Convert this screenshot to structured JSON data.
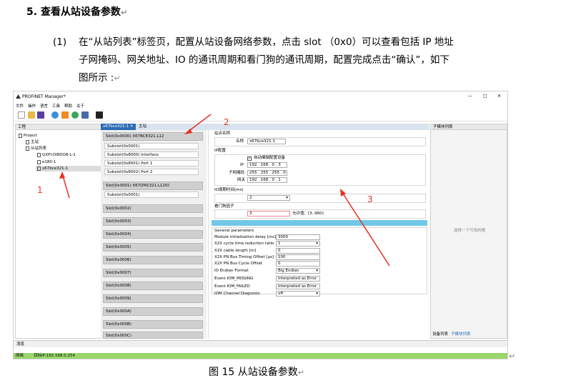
{
  "document": {
    "heading": "5.  查看从站设备参数",
    "para_number": "(1)",
    "para_lines": [
      "在“从站列表”标签页，配置从站设备网络参数，点击 slot （0x0）可以查看包括 IP 地址",
      "子网掩码、网关地址、IO 的通讯周期和看门狗的通讯周期，配置完成点击“确认”，如下",
      "图所示 :"
    ],
    "caption": "图 15 从站设备参数",
    "para_mark": "↵"
  },
  "app": {
    "title": "PROFINET Manager*",
    "window_controls": [
      "—",
      "□",
      "✕"
    ],
    "menu": [
      "文件",
      "操作",
      "语言",
      "工具",
      "帮助",
      "关于"
    ],
    "toolbar_icons": [
      "new-file-icon",
      "open-folder-icon",
      "save-icon",
      "refresh-icon",
      "export-icon",
      "network-icon",
      "device-icon",
      "help-icon"
    ],
    "left_panel": {
      "header": "工程",
      "tree": [
        "Project",
        "主站",
        "从站列表",
        "GXPI-DI8DO8-L-1",
        "e180-1",
        "x67bce321-1"
      ]
    },
    "tabs": [
      "x67bce321-1  ✕",
      "主站"
    ],
    "slots": {
      "slot0": "Slot(0x0000)   X67BCE321.L12",
      "slot0_subslots": [
        "Subslot(0x0001)",
        "Subslot(0x8000)   Interface",
        "Subslot(0x8001)   Port 1",
        "Subslot(0x8002)   Port 2"
      ],
      "slot1": "Slot(0x0001)     X67DM1321.L12IO",
      "slot1_subslots": [
        "Subslot(0x0001)"
      ],
      "empty_slots": [
        "Slot(0x0002)",
        "Slot(0x0003)",
        "Slot(0x0004)",
        "Slot(0x0005)",
        "Slot(0x0006)",
        "Slot(0x0007)",
        "Slot(0x0008)",
        "Slot(0x0009)",
        "Slot(0x000A)",
        "Slot(0x000B)",
        "Slot(0x000C)"
      ]
    },
    "props": {
      "station_name_group": "站点名称",
      "name_label": "名称",
      "name_value": "x67bce321-1",
      "ip_group": "IP配置",
      "auto_config_label": "自动编辑配置设备",
      "ip_label": "IP",
      "ip_value": "192 . 168 .  0  .  3",
      "mask_label": "子网掩码",
      "mask_value": "255 . 255 . 255 .  0",
      "gateway_label": "网关",
      "gateway_value": "192 . 168 .  0  .  1",
      "io_cycle_group": "IO周期时间(ms)",
      "io_cycle_value": "2",
      "watchdog_group": "看门狗因子",
      "watchdog_value": "3",
      "watchdog_range": "允许值：[3..960]",
      "general_title": "General parameters",
      "params": [
        {
          "name": "Module initialization delay [ms]",
          "value": "3000"
        },
        {
          "name": "X2X cycle time reduction ratio",
          "value": "1"
        },
        {
          "name": "X2X cable length [m]",
          "value": "0"
        },
        {
          "name": "X2X PN Bus Timing Offset [µs]",
          "value": "100"
        },
        {
          "name": "X2X PN Bus Cycle Offset",
          "value": "0"
        },
        {
          "name": "IO Endian Format",
          "value": "Big Endian"
        },
        {
          "name": "Event IOM_MISSING",
          "value": "Interpreted as Error"
        },
        {
          "name": "Event IOM_FAILED",
          "value": "Interpreted as Error"
        },
        {
          "name": "IOM Channel Diagnosis",
          "value": "off"
        }
      ]
    },
    "right_panel": {
      "header": "子模块列表",
      "placeholder": "选择一个可用的槽",
      "bottom_tabs": [
        "设备列表",
        "子模块列表"
      ]
    },
    "output_label": "消息",
    "status_connected": "网络",
    "status_ip": "目标IP:192.168.0.254"
  },
  "annotations": {
    "labels": [
      "1",
      "2",
      "3"
    ],
    "color": "#e8301f"
  },
  "colors": {
    "status_green": "#9ad66b",
    "highlight_blue": "#70c8e8",
    "tab_active": "#2b6cb5"
  }
}
